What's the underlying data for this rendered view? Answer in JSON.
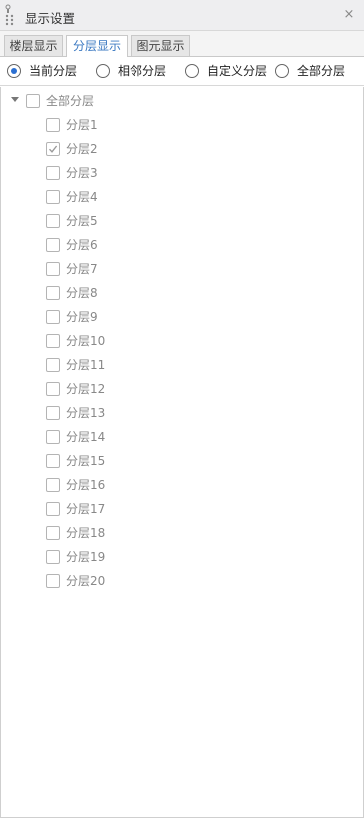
{
  "panel": {
    "title": "显示设置",
    "close_glyph": "×",
    "icons": {
      "grip": "drag-grip-icon",
      "close": "close-icon"
    }
  },
  "tabs": [
    {
      "label": "楼层显示",
      "active": false
    },
    {
      "label": "分层显示",
      "active": true
    },
    {
      "label": "图元显示",
      "active": false
    }
  ],
  "scope_options": [
    {
      "label": "当前分层",
      "selected": true
    },
    {
      "label": "相邻分层",
      "selected": false
    },
    {
      "label": "自定义分层",
      "selected": false
    },
    {
      "label": "全部分层",
      "selected": false
    }
  ],
  "tree": {
    "root": {
      "label": "全部分层",
      "checked": false,
      "expanded": true
    },
    "layers": [
      {
        "label": "分层1",
        "checked": false
      },
      {
        "label": "分层2",
        "checked": true
      },
      {
        "label": "分层3",
        "checked": false
      },
      {
        "label": "分层4",
        "checked": false
      },
      {
        "label": "分层5",
        "checked": false
      },
      {
        "label": "分层6",
        "checked": false
      },
      {
        "label": "分层7",
        "checked": false
      },
      {
        "label": "分层8",
        "checked": false
      },
      {
        "label": "分层9",
        "checked": false
      },
      {
        "label": "分层10",
        "checked": false
      },
      {
        "label": "分层11",
        "checked": false
      },
      {
        "label": "分层12",
        "checked": false
      },
      {
        "label": "分层13",
        "checked": false
      },
      {
        "label": "分层14",
        "checked": false
      },
      {
        "label": "分层15",
        "checked": false
      },
      {
        "label": "分层16",
        "checked": false
      },
      {
        "label": "分层17",
        "checked": false
      },
      {
        "label": "分层18",
        "checked": false
      },
      {
        "label": "分层19",
        "checked": false
      },
      {
        "label": "分层20",
        "checked": false
      }
    ]
  },
  "colors": {
    "accent": "#2b6fd1",
    "active_tab_text": "#3b79c2",
    "check_mark": "#9a9a9a"
  }
}
